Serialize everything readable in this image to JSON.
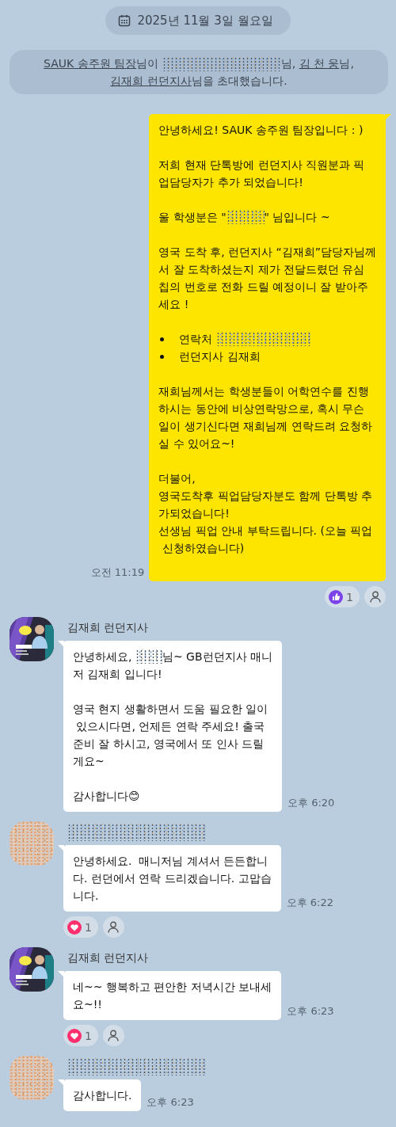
{
  "date_divider": {
    "text": "2025년 11월 3일 월요일"
  },
  "messages": [
    {
      "kind": "system",
      "parts": [
        {
          "kind": "link",
          "text": "SAUK 송주원 팀장"
        },
        {
          "kind": "text",
          "text": "님이 "
        },
        {
          "kind": "redacted"
        },
        {
          "kind": "text",
          "text": "님, "
        },
        {
          "kind": "link",
          "text": "김 천 웅"
        },
        {
          "kind": "text",
          "text": "님, "
        },
        {
          "kind": "link",
          "text": "김재희 런던지사"
        },
        {
          "kind": "text",
          "text": "님을 초대했습니다."
        }
      ]
    },
    {
      "kind": "sent",
      "time": "오전 11:19",
      "lines": [
        {
          "kind": "text",
          "parts": [
            {
              "kind": "text",
              "text": "안녕하세요! SAUK 송주원 팀장입니다 : )"
            }
          ]
        },
        {
          "kind": "gap"
        },
        {
          "kind": "text",
          "parts": [
            {
              "kind": "text",
              "text": "저희 현재 단톡방에 런던지사 직원분과 픽"
            }
          ]
        },
        {
          "kind": "text",
          "parts": [
            {
              "kind": "text",
              "text": "업담당자가 추가 되었습니다!"
            }
          ]
        },
        {
          "kind": "gap"
        },
        {
          "kind": "text",
          "parts": [
            {
              "kind": "text",
              "text": "울 학생분은 \""
            },
            {
              "kind": "redacted"
            },
            {
              "kind": "text",
              "text": "\" 님입니다 ~"
            }
          ]
        },
        {
          "kind": "gap"
        },
        {
          "kind": "text",
          "parts": [
            {
              "kind": "text",
              "text": "영국 도착 후, 런던지사 “김재희”담당자님께"
            }
          ]
        },
        {
          "kind": "text",
          "parts": [
            {
              "kind": "text",
              "text": "서 잘 도착하셨는지 제가 전달드렸던 유심"
            }
          ]
        },
        {
          "kind": "text",
          "parts": [
            {
              "kind": "text",
              "text": "칩의 번호로 전화 드릴 예정이니 잘 받아주"
            }
          ]
        },
        {
          "kind": "text",
          "parts": [
            {
              "kind": "text",
              "text": "세요 !"
            }
          ]
        },
        {
          "kind": "gap"
        },
        {
          "kind": "bullet",
          "parts": [
            {
              "kind": "text",
              "text": "연락처 "
            },
            {
              "kind": "redacted"
            }
          ]
        },
        {
          "kind": "bullet",
          "parts": [
            {
              "kind": "text",
              "text": "런던지사 김재희"
            }
          ]
        },
        {
          "kind": "gap"
        },
        {
          "kind": "text",
          "parts": [
            {
              "kind": "text",
              "text": "재희님께서는 학생분들이 어학연수를 진행"
            }
          ]
        },
        {
          "kind": "text",
          "parts": [
            {
              "kind": "text",
              "text": "하시는 동안에 비상연락망으로, 혹시 무슨"
            }
          ]
        },
        {
          "kind": "text",
          "parts": [
            {
              "kind": "text",
              "text": "일이 생기신다면 재희님께 연락드려 요청하"
            }
          ]
        },
        {
          "kind": "text",
          "parts": [
            {
              "kind": "text",
              "text": "실 수 있어요~!"
            }
          ]
        },
        {
          "kind": "gap"
        },
        {
          "kind": "text",
          "parts": [
            {
              "kind": "text",
              "text": "더불어,"
            }
          ]
        },
        {
          "kind": "text",
          "parts": [
            {
              "kind": "text",
              "text": "영국도착후 픽업담당자분도 함께 단톡방 추"
            }
          ]
        },
        {
          "kind": "text",
          "parts": [
            {
              "kind": "text",
              "text": "가되었습니다!"
            }
          ]
        },
        {
          "kind": "text",
          "parts": [
            {
              "kind": "text",
              "text": "선생님 픽업 안내 부탁드립니다. (오늘 픽업"
            }
          ]
        },
        {
          "kind": "text",
          "parts": [
            {
              "kind": "text",
              "text": " 신청하였습니다)"
            }
          ]
        },
        {
          "kind": "gap"
        }
      ],
      "reactions": [
        {
          "kind": "like",
          "count": "1"
        }
      ]
    },
    {
      "kind": "received",
      "sender": {
        "kind": "named",
        "name": "김재희 런던지사"
      },
      "avatar": {
        "kind": "picture"
      },
      "time": "오후 6:20",
      "lines": [
        {
          "kind": "text",
          "parts": [
            {
              "kind": "text",
              "text": "안녕하세요, "
            },
            {
              "kind": "redacted"
            },
            {
              "kind": "text",
              "text": "님~ GB런던지사 매니"
            }
          ]
        },
        {
          "kind": "text",
          "parts": [
            {
              "kind": "text",
              "text": "저 김재희 입니다!"
            }
          ]
        },
        {
          "kind": "gap"
        },
        {
          "kind": "text",
          "parts": [
            {
              "kind": "text",
              "text": "영국 현지 생활하면서 도움 필요한 일이"
            }
          ]
        },
        {
          "kind": "text",
          "parts": [
            {
              "kind": "text",
              "text": " 있으시다면, 언제든 연락 주세요! 출국"
            }
          ]
        },
        {
          "kind": "text",
          "parts": [
            {
              "kind": "text",
              "text": "준비 잘 하시고, 영국에서 또 인사 드릴"
            }
          ]
        },
        {
          "kind": "text",
          "parts": [
            {
              "kind": "text",
              "text": "게요~"
            }
          ]
        },
        {
          "kind": "gap"
        },
        {
          "kind": "text",
          "parts": [
            {
              "kind": "text",
              "text": "감사합니다😊"
            }
          ]
        }
      ]
    },
    {
      "kind": "received",
      "sender": {
        "kind": "redacted"
      },
      "avatar": {
        "kind": "redacted"
      },
      "time": "오후 6:22",
      "lines": [
        {
          "kind": "text",
          "parts": [
            {
              "kind": "text",
              "text": "안녕하세요.  매니저님 계셔서 든든합니"
            }
          ]
        },
        {
          "kind": "text",
          "parts": [
            {
              "kind": "text",
              "text": "다. 런던에서 연락 드리겠습니다. 고맙습"
            }
          ]
        },
        {
          "kind": "text",
          "parts": [
            {
              "kind": "text",
              "text": "니다."
            }
          ]
        }
      ],
      "reactions": [
        {
          "kind": "heart",
          "count": "1"
        }
      ]
    },
    {
      "kind": "received",
      "sender": {
        "kind": "named",
        "name": "김재희 런던지사"
      },
      "avatar": {
        "kind": "picture"
      },
      "time": "오후 6:23",
      "lines": [
        {
          "kind": "text",
          "parts": [
            {
              "kind": "text",
              "text": "네~~ 행복하고 편안한 저녁시간 보내세"
            }
          ]
        },
        {
          "kind": "text",
          "parts": [
            {
              "kind": "text",
              "text": "요~!!"
            }
          ]
        }
      ],
      "reactions": [
        {
          "kind": "heart",
          "count": "1"
        }
      ]
    },
    {
      "kind": "received",
      "sender": {
        "kind": "redacted"
      },
      "avatar": {
        "kind": "redacted"
      },
      "time": "오후 6:23",
      "lines": [
        {
          "kind": "text",
          "parts": [
            {
              "kind": "text",
              "text": "감사합니다."
            }
          ]
        }
      ]
    }
  ]
}
